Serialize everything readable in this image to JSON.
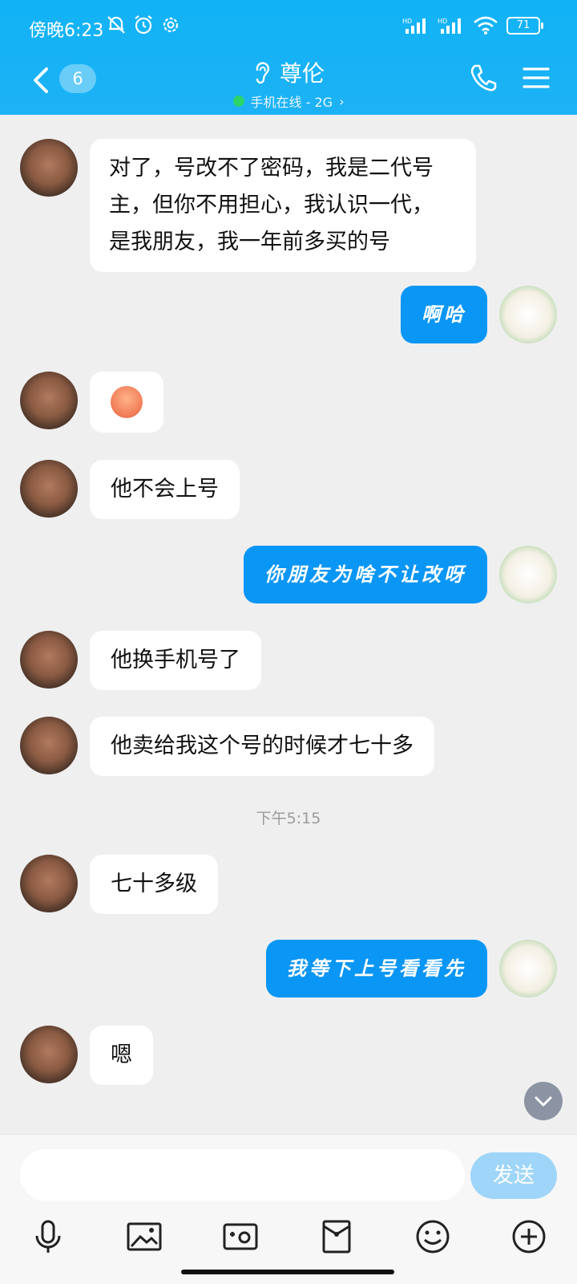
{
  "status_bar": {
    "time": "傍晚6:23",
    "battery": "71"
  },
  "header": {
    "unread_count": "6",
    "contact_name": "尊伦",
    "contact_status": "手机在线 - 2G",
    "status_chevron": "›"
  },
  "messages": [
    {
      "from": "friend",
      "text": "对了，号改不了密码，我是二代号\n主，但你不用担心，我认识一代，\n是我朋友，我一年前多买的号"
    },
    {
      "from": "me",
      "text": "啊哈"
    },
    {
      "from": "friend",
      "type": "emoji",
      "emoji": "eye-roll-face-emoji"
    },
    {
      "from": "friend",
      "text": "他不会上号"
    },
    {
      "from": "me",
      "text": "你朋友为啥不让改呀"
    },
    {
      "from": "friend",
      "text": "他换手机号了"
    },
    {
      "from": "friend",
      "text": "他卖给我这个号的时候才七十多"
    },
    {
      "timestamp": "下午5:15"
    },
    {
      "from": "friend",
      "text": "七十多级"
    },
    {
      "from": "me",
      "text": "我等下上号看看先"
    },
    {
      "from": "friend",
      "text": "嗯"
    }
  ],
  "composer": {
    "input_value": "",
    "send_label": "发送"
  },
  "icons": {
    "toolbar": [
      "microphone-icon",
      "image-icon",
      "camera-icon",
      "red-packet-icon",
      "emoji-icon",
      "plus-icon"
    ]
  },
  "colors": {
    "header": "#1db2f5",
    "outgoing_bubble": "#0a96f5",
    "incoming_bubble": "#ffffff",
    "background": "#efefef",
    "online": "#2bd36a"
  }
}
